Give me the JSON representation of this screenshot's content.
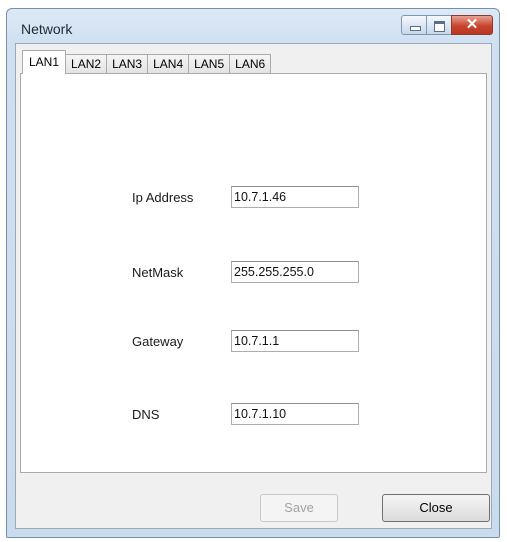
{
  "window": {
    "title": "Network"
  },
  "tabs": [
    {
      "label": "LAN1",
      "active": true
    },
    {
      "label": "LAN2",
      "active": false
    },
    {
      "label": "LAN3",
      "active": false
    },
    {
      "label": "LAN4",
      "active": false
    },
    {
      "label": "LAN5",
      "active": false
    },
    {
      "label": "LAN6",
      "active": false
    }
  ],
  "fields": {
    "ip_address": {
      "label": "Ip Address",
      "value": "10.7.1.46"
    },
    "netmask": {
      "label": "NetMask",
      "value": "255.255.255.0"
    },
    "gateway": {
      "label": "Gateway",
      "value": "10.7.1.1"
    },
    "dns": {
      "label": "DNS",
      "value": "10.7.1.10"
    }
  },
  "buttons": {
    "save_label": "Save",
    "save_enabled": false,
    "close_label": "Close"
  },
  "icons": {
    "minimize": "minimize-icon",
    "maximize": "maximize-icon",
    "close": "close-icon"
  },
  "colors": {
    "close_button": "#c8452f",
    "title_bar": "#dce9f6"
  }
}
